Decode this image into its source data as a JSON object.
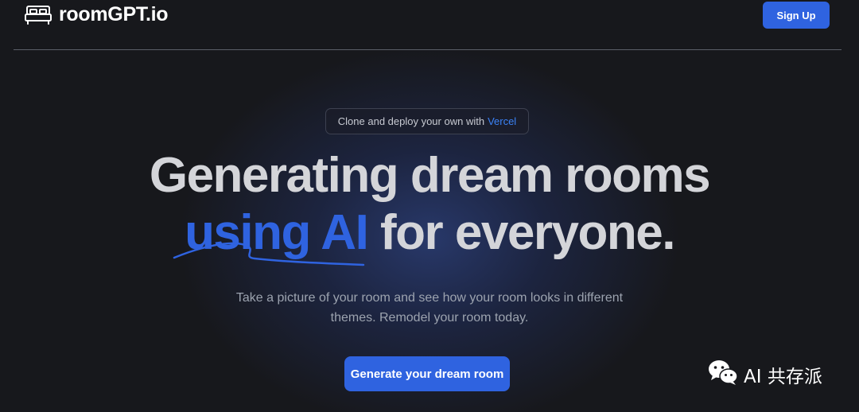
{
  "header": {
    "logo_text": "roomGPT.io",
    "logo_icon": "bed-icon",
    "signup_label": "Sign Up"
  },
  "announcement": {
    "text": "Clone and deploy your own with",
    "link_text": "Vercel"
  },
  "hero": {
    "line1": "Generating dream rooms",
    "accent": "using AI",
    "line2_rest": " for everyone.",
    "subtitle": "Take a picture of your room and see how your room looks in different themes. Remodel your room today.",
    "cta_label": "Generate your dream room"
  },
  "watermark": {
    "icon": "wechat-icon",
    "text": "AI 共存派"
  },
  "colors": {
    "background": "#17181c",
    "accent": "#2f63e0",
    "link": "#3b82f6",
    "headline": "#d4d5d9",
    "muted": "#9ca3af"
  }
}
